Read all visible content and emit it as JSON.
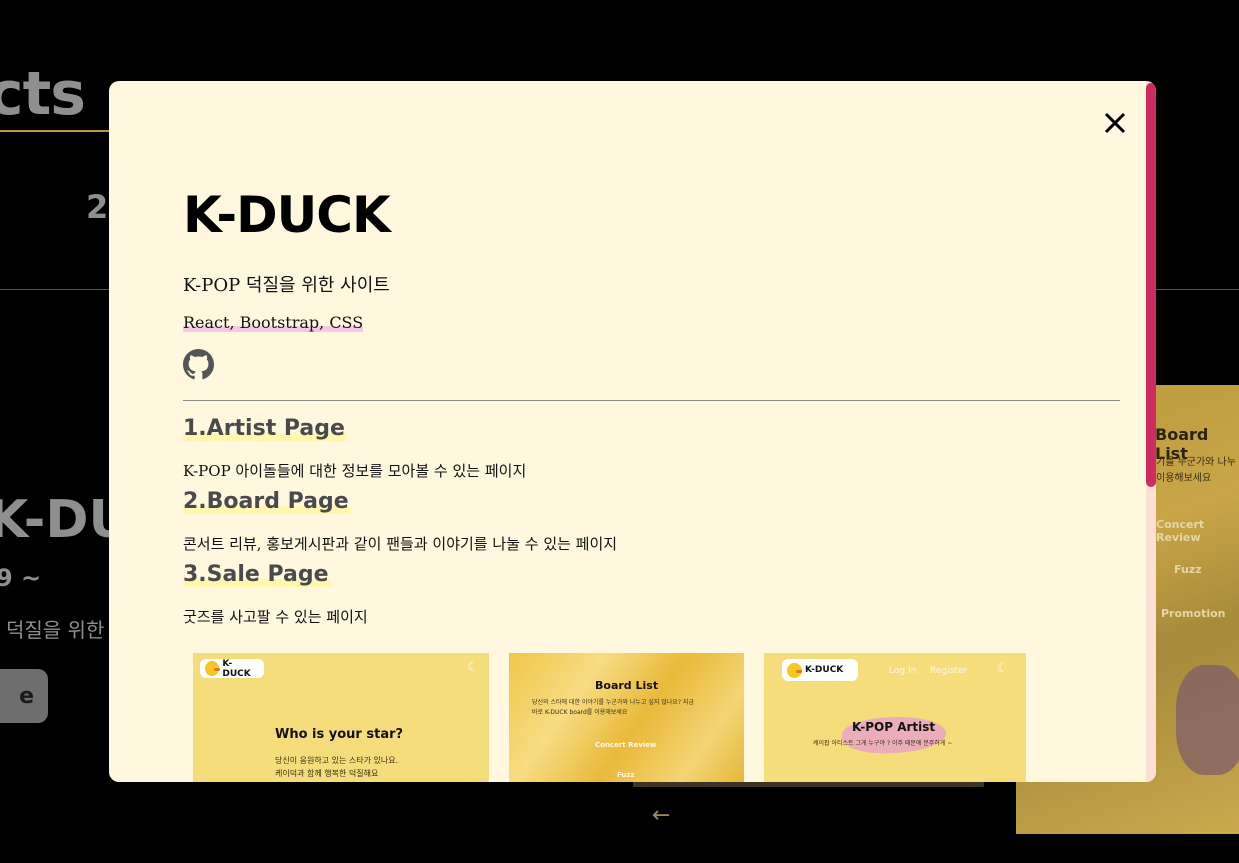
{
  "background": {
    "section_title": "cts",
    "number": "2",
    "project_title": "K-DUC",
    "date": "9 ~",
    "description": "덕질을 위한",
    "button_label": "e",
    "arrow": "←",
    "side_card": {
      "title": "Board List",
      "text_line1": "기를 누군가와 나누",
      "text_line2": "이용해보세요",
      "links": [
        "Concert Review",
        "Fuzz",
        "Promotion"
      ]
    }
  },
  "modal": {
    "title": "K-DUCK",
    "subtitle": "K-POP 덕질을 위한 사이트",
    "tech": "React, Bootstrap, CSS",
    "github_icon": "github-icon",
    "close_icon": "close-icon",
    "sections": [
      {
        "heading": "1.Artist Page",
        "text": "K-POP 아이돌들에 대한 정보를 모아볼 수 있는 페이지"
      },
      {
        "heading": "2.Board Page",
        "text": "콘서트 리뷰, 홍보게시판과 같이 팬들과 이야기를 나눌 수 있는 페이지"
      },
      {
        "heading": "3.Sale Page",
        "text": "굿즈를 사고팔 수 있는 페이지"
      }
    ],
    "screenshots": [
      {
        "logo": "K-DUCK",
        "heading": "Who is your star?",
        "line1": "당신이 응원하고 있는 스타가 있나요.",
        "line2": "케이덕과 함께 행복한 덕질해요"
      },
      {
        "heading": "Board List",
        "line1": "당신의 스타에 대한 이야기를 누군가와 나누고 싶지 않나요? 지금",
        "line2": "바로 K-DUCK board를 이용해보세요",
        "link1": "Concert Review",
        "link2": "Fuzz"
      },
      {
        "logo": "K-DUCK",
        "login": "Log In",
        "register": "Register",
        "heading": "K-POP Artist",
        "line1": "케이팝 아티스트 그게 누구야 ? 이주 때문에 분주하게 ~"
      }
    ]
  },
  "colors": {
    "modal_bg": "#fff8df",
    "scroll_thumb": "#cc2c5e",
    "accent_gold": "#b8974a",
    "highlight_yellow": "#fff7b0",
    "highlight_pink": "#f3c9e4"
  }
}
